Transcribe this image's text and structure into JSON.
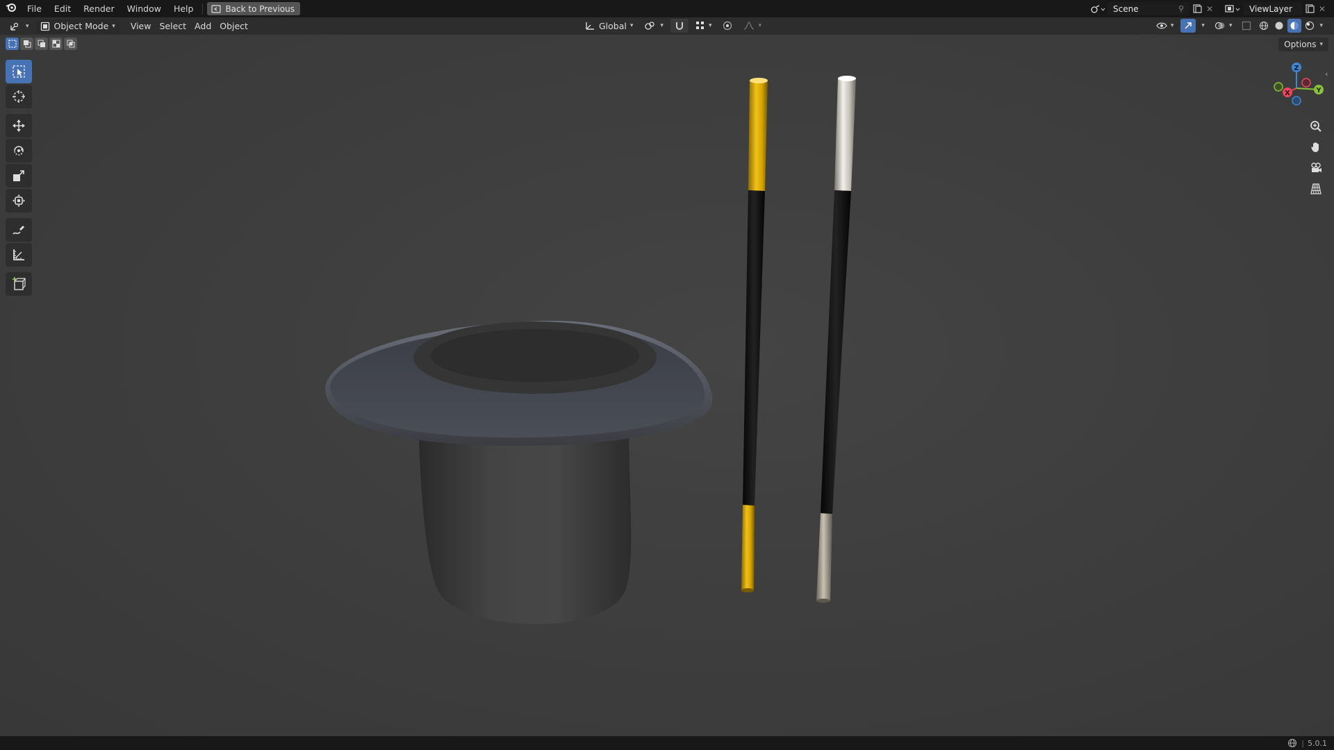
{
  "topbar": {
    "menus": [
      "File",
      "Edit",
      "Render",
      "Window",
      "Help"
    ],
    "back_label": "Back to Previous",
    "scene_name": "Scene",
    "view_layer": "ViewLayer"
  },
  "header": {
    "mode_label": "Object Mode",
    "menus": [
      "View",
      "Select",
      "Add",
      "Object"
    ],
    "orientation_label": "Global"
  },
  "viewport": {
    "options_label": "Options",
    "gizmo_axes": [
      "X",
      "Y",
      "Z"
    ]
  },
  "statusbar": {
    "version": "5.0.1"
  },
  "colors": {
    "accent": "#4772b3",
    "axis_x": "#e8475f",
    "axis_y": "#8ac03a",
    "axis_z": "#3d86d8"
  }
}
